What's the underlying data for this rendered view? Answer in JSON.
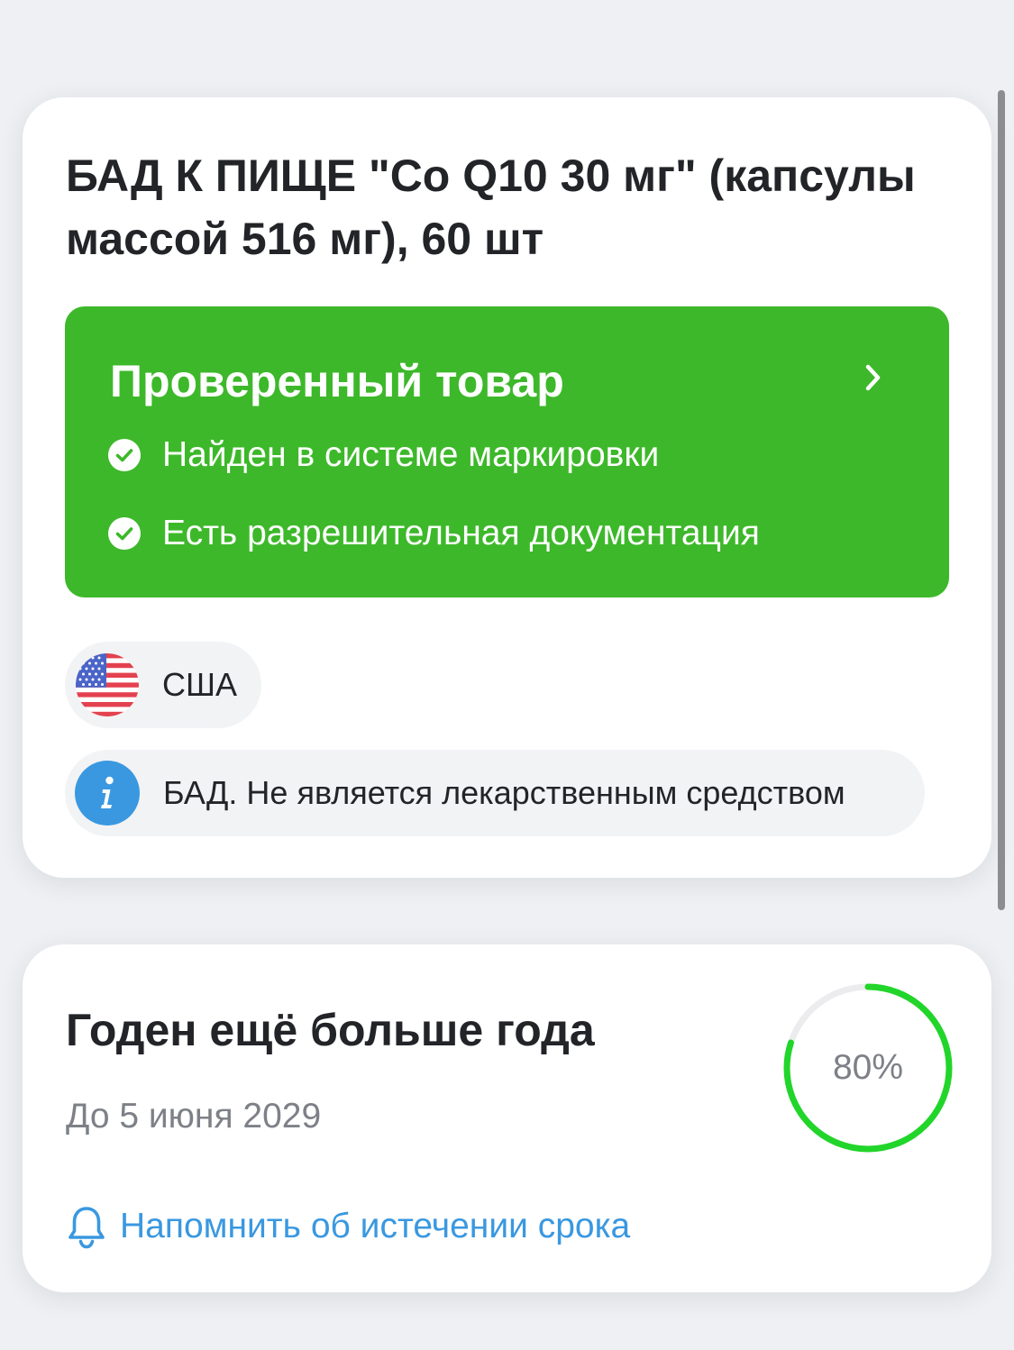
{
  "product": {
    "title": "БАД К ПИЩЕ \"Co Q10 30 мг\" (капсулы массой 516 мг), 60 шт",
    "verification": {
      "title": "Проверенный товар",
      "items": [
        "Найден в системе маркировки",
        "Есть разрешительная документация"
      ],
      "color": "#3db82a"
    },
    "country": {
      "name": "США",
      "flag_icon": "usa-flag-icon"
    },
    "info": {
      "text": "БАД. Не является лекарственным средством",
      "icon": "info-icon",
      "icon_color": "#3a98e0"
    }
  },
  "expiry": {
    "title": "Годен ещё больше года",
    "date": "До 5 июня 2029",
    "progress_label": "80%",
    "progress_fraction": 0.8,
    "progress_color": "#22d52a",
    "reminder_label": "Напомнить об истечении срока",
    "reminder_color": "#3a98e0"
  }
}
